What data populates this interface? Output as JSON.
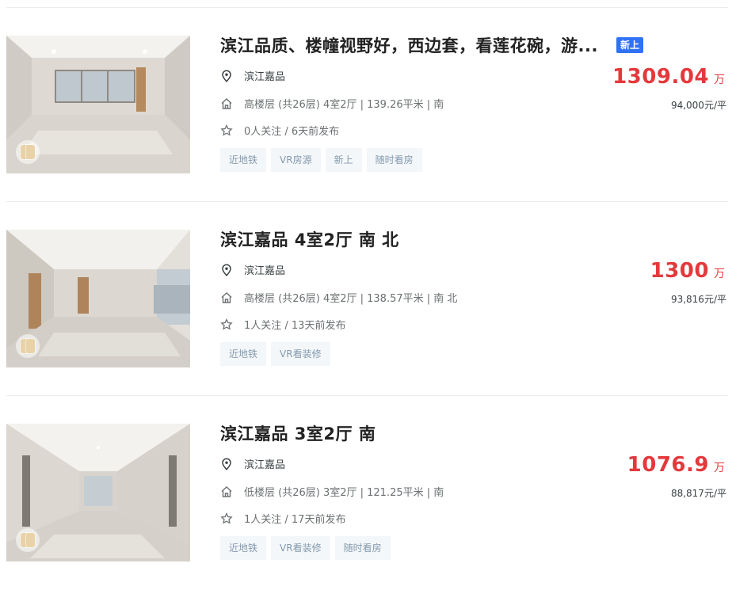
{
  "listings": [
    {
      "title": "滨江品质、楼幢视野好，西边套，看莲花碗，游...",
      "badge": "新上",
      "community": "滨江嘉品",
      "info": "高楼层 (共26层) 4室2厅 | 139.26平米 | 南",
      "follow": "0人关注 / 6天前发布",
      "tags": [
        "近地铁",
        "VR房源",
        "新上",
        "随时看房"
      ],
      "price": "1309.04",
      "price_unit": "万",
      "unit_price": "94,000元/平"
    },
    {
      "title": "滨江嘉品 4室2厅 南 北",
      "badge": "",
      "community": "滨江嘉品",
      "info": "高楼层 (共26层) 4室2厅 | 138.57平米 | 南 北",
      "follow": "1人关注 / 13天前发布",
      "tags": [
        "近地铁",
        "VR看装修"
      ],
      "price": "1300",
      "price_unit": "万",
      "unit_price": "93,816元/平"
    },
    {
      "title": "滨江嘉品 3室2厅 南",
      "badge": "",
      "community": "滨江嘉品",
      "info": "低楼层 (共26层) 3室2厅 | 121.25平米 | 南",
      "follow": "1人关注 / 17天前发布",
      "tags": [
        "近地铁",
        "VR看装修",
        "随时看房"
      ],
      "price": "1076.9",
      "price_unit": "万",
      "unit_price": "88,817元/平"
    }
  ],
  "icons": {
    "location": "location-pin-icon",
    "house": "house-icon",
    "follow": "star-icon",
    "vr": "vr-badge-icon"
  },
  "colors": {
    "price": "#e4393c",
    "badge_new": "#3072f6",
    "tag_text": "#849aae",
    "tag_bg": "#f4f7f9"
  }
}
